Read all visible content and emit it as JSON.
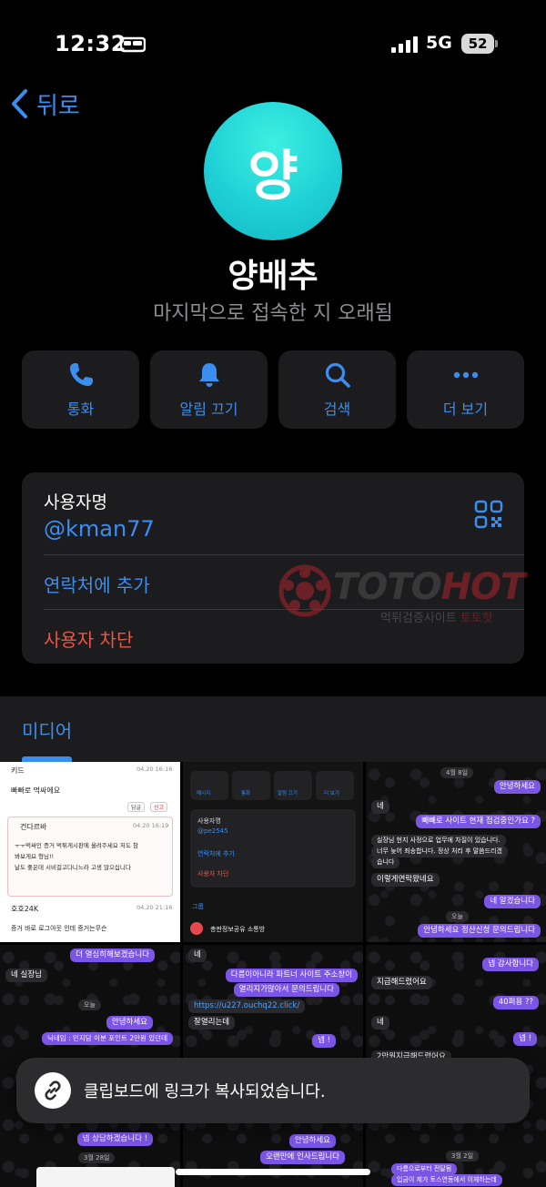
{
  "status_bar": {
    "time": "12:32",
    "network": "5G",
    "battery": "52"
  },
  "nav": {
    "back_label": "뒤로"
  },
  "profile": {
    "avatar_initial": "양",
    "name": "양배추",
    "last_seen": "마지막으로 접속한 지 오래됨",
    "avatar_color": "#1fd1d6"
  },
  "actions": [
    {
      "label": "통화",
      "icon": "phone-icon"
    },
    {
      "label": "알림 끄기",
      "icon": "bell-icon"
    },
    {
      "label": "검색",
      "icon": "search-icon"
    },
    {
      "label": "더 보기",
      "icon": "more-icon"
    }
  ],
  "info": {
    "username_label": "사용자명",
    "username": "@kman77",
    "add_contact": "연락처에 추가",
    "block_user": "사용자 차단"
  },
  "watermark": {
    "title_part1": "TOTO",
    "title_part2": "HOT",
    "subtitle_part1": "먹튀검증사이트",
    "subtitle_part2": "토토핫"
  },
  "media": {
    "tab_label": "미디어"
  },
  "thumbnails": {
    "t1": {
      "header_name": "키드",
      "header_time": "04.20 16:16",
      "message": "빠빠로 먹싸에요",
      "reply_name": "건다르바",
      "reply_time": "04.20 16:19",
      "reply_lines": [
        "ㅜㅜ먹싸인 증거 먹튀게시판에 올려주세요 저도 참",
        "봐보게요 형님!!",
        "날도 좋은데 시비걸고다니느라 고생 많으십니다"
      ],
      "footer_name": "호호24K",
      "footer_time": "04.20 21:16",
      "footer_msg": "증거 바로 로그아웃 인데 증거는무슨",
      "pill_reply": "답글",
      "pill_report": "신고"
    },
    "t2": {
      "btns": [
        "메시지",
        "통화",
        "알림 끄기",
        "더 보기"
      ],
      "username_label": "사용자명",
      "username": "@pe2545",
      "add_contact": "연락처에 추가",
      "block": "사용자 차단",
      "group_tab": "그룹",
      "group_name": "총판정보공유 소통방"
    },
    "t3": {
      "date": "4월 8일",
      "messages": [
        "안녕하세요",
        "네",
        "빼빼로 사이트 현재 점검중인가요 ?",
        "실장님 현지 사정으로 업무에 차질이 있습니다.",
        "너무 늦어 죄송합니다. 정상 처리 후 말씀드리겠",
        "습니다",
        "이렇게연락왔네요",
        "네 알겠습니다",
        "오늘",
        "안녕하세요 정산신청 문의드립니다"
      ]
    },
    "t4": {
      "messages": [
        "더 열심히해보겠습니다",
        "네 실장님",
        "오늘",
        "안녕하세요",
        "닉네임 : 민지담 이분 포인트 2만원 있던데",
        "넵 상담하겠습니다 !",
        "3월 28일"
      ]
    },
    "t5": {
      "messages": [
        "네",
        "다름이아니라 파트너 사이트 주소창이",
        "열리지가않아서 문의드립니다",
        "https://u227.ouchq22.click/",
        "잘열리는데",
        "넵 !",
        "안녕하세요",
        "오랜만에 인사드립니다"
      ]
    },
    "t6": {
      "messages": [
        "넵 감사합니다",
        "지급해드렸어요",
        "40퍼용 ??",
        "네",
        "넵 !",
        "2만원지급해드렸어요",
        "3월 2일",
        "다름으로부터 전달됨",
        "입금이 제가 토스연동에서 이체하는데"
      ]
    }
  },
  "toast": {
    "message": "클립보드에 링크가 복사되었습니다.",
    "icon": "link-icon"
  }
}
